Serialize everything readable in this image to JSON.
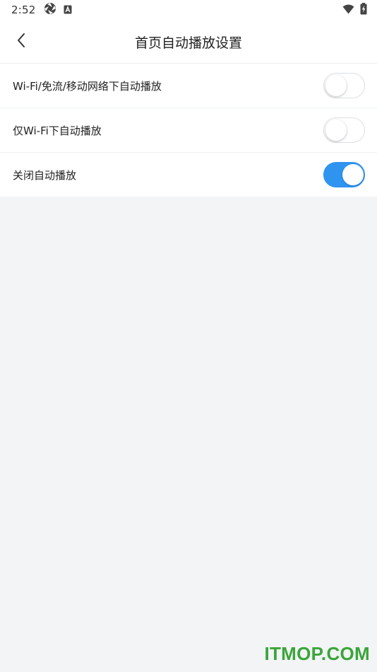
{
  "status_bar": {
    "time": "2:52",
    "left_icons": [
      "aperture-icon",
      "a-box-icon"
    ],
    "right_icons": [
      "wifi-icon",
      "battery-charging-icon"
    ]
  },
  "app_bar": {
    "back_icon": "chevron-left-icon",
    "title": "首页自动播放设置"
  },
  "settings": [
    {
      "label": "Wi-Fi/免流/移动网络下自动播放",
      "enabled": false
    },
    {
      "label": "仅Wi-Fi下自动播放",
      "enabled": false
    },
    {
      "label": "关闭自动播放",
      "enabled": true
    }
  ],
  "colors": {
    "accent": "#2f94f0",
    "background": "#f3f4f6",
    "surface": "#ffffff",
    "watermark": "#3aa53a"
  },
  "watermark": "ITMOP.COM"
}
